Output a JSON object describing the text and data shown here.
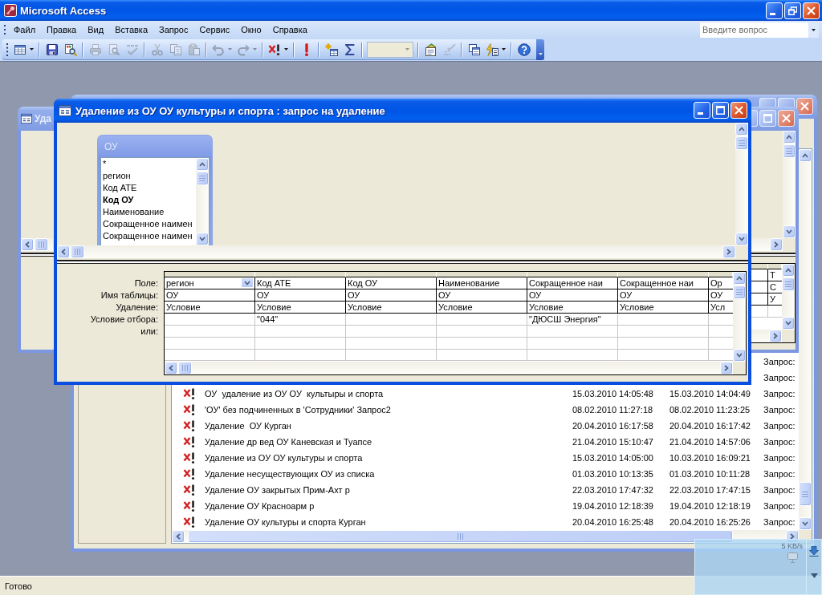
{
  "window": {
    "title": "Microsoft Access"
  },
  "menu": [
    "Файл",
    "Правка",
    "Вид",
    "Вставка",
    "Запрос",
    "Сервис",
    "Окно",
    "Справка"
  ],
  "help_search": {
    "placeholder": "Введите вопрос"
  },
  "toolbar": [
    [
      {
        "kind": "datasheet",
        "dropdown": true,
        "disabled": false
      }
    ],
    [
      {
        "kind": "save",
        "dropdown": false,
        "disabled": false
      },
      {
        "kind": "find",
        "dropdown": false,
        "disabled": false
      }
    ],
    [
      {
        "kind": "print",
        "dropdown": false,
        "disabled": true
      },
      {
        "kind": "preview",
        "dropdown": false,
        "disabled": true
      },
      {
        "kind": "spelling",
        "dropdown": false,
        "disabled": true
      }
    ],
    [
      {
        "kind": "cut",
        "dropdown": false,
        "disabled": true
      },
      {
        "kind": "copy",
        "dropdown": false,
        "disabled": true
      },
      {
        "kind": "paste",
        "dropdown": false,
        "disabled": true
      }
    ],
    [
      {
        "kind": "undo",
        "dropdown": true,
        "disabled": true
      },
      {
        "kind": "redo",
        "dropdown": true,
        "disabled": true
      }
    ],
    [
      {
        "kind": "query_type",
        "dropdown": true,
        "disabled": false
      }
    ],
    [
      {
        "kind": "run",
        "dropdown": false,
        "disabled": false
      }
    ],
    [
      {
        "kind": "show_table",
        "dropdown": false,
        "disabled": false
      },
      {
        "kind": "totals",
        "dropdown": false,
        "disabled": false
      }
    ],
    [
      {
        "kind": "combo",
        "disabled": true
      }
    ],
    [
      {
        "kind": "properties",
        "dropdown": false,
        "disabled": false
      },
      {
        "kind": "builder",
        "dropdown": false,
        "disabled": true
      }
    ],
    [
      {
        "kind": "database_window",
        "dropdown": false,
        "disabled": false
      },
      {
        "kind": "new_object",
        "dropdown": true,
        "disabled": false
      }
    ],
    [
      {
        "kind": "help",
        "dropdown": false,
        "disabled": false
      }
    ]
  ],
  "database_window": {
    "rows": [
      {
        "column_4": "Запрос:"
      },
      {
        "column_4": "Запрос:"
      },
      {
        "column_1": "ОУ  удаление из ОУ ОУ  культыры и спорта",
        "column_2": "15.03.2010 14:05:48",
        "column_3": "15.03.2010 14:04:49",
        "column_4": "Запрос:"
      },
      {
        "column_1": "'ОУ' без подчиненных в 'Сотрудники' Запрос2",
        "column_2": "08.02.2010 11:27:18",
        "column_3": "08.02.2010 11:23:25",
        "column_4": "Запрос:"
      },
      {
        "column_1": "Удаление  ОУ Курган",
        "column_2": "20.04.2010 16:17:58",
        "column_3": "20.04.2010 16:17:42",
        "column_4": "Запрос:"
      },
      {
        "column_1": "Удаление др вед ОУ Каневская и Туапсе",
        "column_2": "21.04.2010 15:10:47",
        "column_3": "21.04.2010 14:57:06",
        "column_4": "Запрос:"
      },
      {
        "column_1": "Удаление из ОУ ОУ культуры и спорта",
        "column_2": "15.03.2010 14:05:00",
        "column_3": "10.03.2010 16:09:21",
        "column_4": "Запрос:"
      },
      {
        "column_1": "Удаление несуществующих ОУ из списка",
        "column_2": "01.03.2010 10:13:35",
        "column_3": "01.03.2010 10:11:28",
        "column_4": "Запрос:"
      },
      {
        "column_1": "Удаление ОУ закрытых Прим-Ахт р",
        "column_2": "22.03.2010 17:47:32",
        "column_3": "22.03.2010 17:47:15",
        "column_4": "Запрос:"
      },
      {
        "column_1": "Удаление ОУ Красноарм р",
        "column_2": "19.04.2010 12:18:39",
        "column_3": "19.04.2010 12:18:19",
        "column_4": "Запрос:"
      },
      {
        "column_1": "Удаление ОУ культуры и спорта Курган",
        "column_2": "20.04.2010 16:25:48",
        "column_3": "20.04.2010 16:25:26",
        "column_4": "Запрос:"
      }
    ]
  },
  "background_query_window": {
    "title": "Уда",
    "grid_column": {
      "field": "Т",
      "table": "С",
      "delete": "У"
    }
  },
  "query_window": {
    "title": "Удаление из ОУ ОУ культуры и спорта : запрос на удаление",
    "table": {
      "title": "ОУ",
      "fields": [
        {
          "name": "*",
          "key": false
        },
        {
          "name": "регион",
          "key": false
        },
        {
          "name": "Код АТЕ",
          "key": false
        },
        {
          "name": "Код ОУ",
          "key": true
        },
        {
          "name": "Наименование",
          "key": false
        },
        {
          "name": "Сокращенное наимен",
          "key": false
        },
        {
          "name": "Сокращенное наимен",
          "key": false
        }
      ]
    },
    "row_labels": [
      "Поле:",
      "Имя таблицы:",
      "Удаление:",
      "Условие отбора:",
      "или:"
    ],
    "columns": [
      {
        "field": "регион",
        "table": "ОУ",
        "delete": "Условие",
        "active": true
      },
      {
        "field": "Код АТЕ",
        "table": "ОУ",
        "delete": "Условие",
        "criteria": "\"044\"",
        "active": false
      },
      {
        "field": "Код ОУ",
        "table": "ОУ",
        "delete": "Условие",
        "active": false
      },
      {
        "field": "Наименование",
        "table": "ОУ",
        "delete": "Условие",
        "active": false
      },
      {
        "field": "Сокращенное наи",
        "table": "ОУ",
        "delete": "Условие",
        "criteria": "\"ДЮСШ Энергия\"",
        "active": false
      },
      {
        "field": "Сокращенное наи",
        "table": "ОУ",
        "delete": "Условие",
        "active": false
      },
      {
        "field": "Ор",
        "table": "ОУ",
        "delete": "Усл",
        "active": false
      }
    ]
  },
  "status_bar": {
    "text": "Готово"
  },
  "network_meter": {
    "reading": "5 KB/s"
  }
}
